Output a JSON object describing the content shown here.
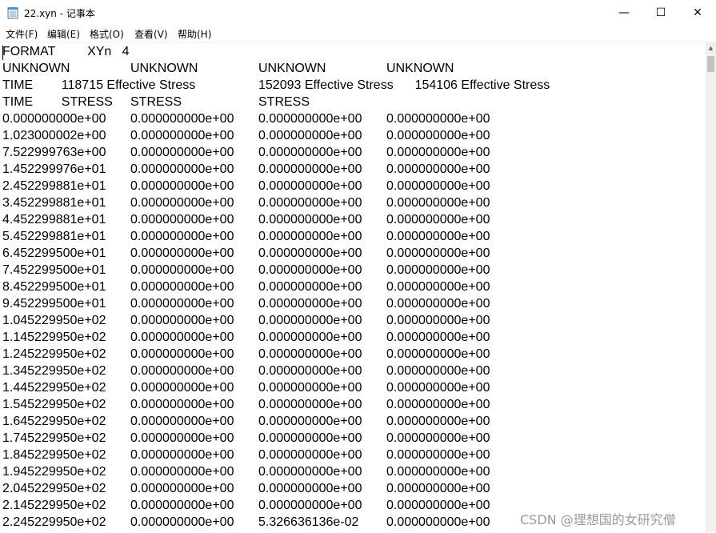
{
  "window": {
    "title": "22.xyn - 记事本",
    "minimize_glyph": "—",
    "maximize_glyph": "☐",
    "close_glyph": "✕"
  },
  "menu": [
    {
      "label": "文件(F)"
    },
    {
      "label": "编辑(E)"
    },
    {
      "label": "格式(O)"
    },
    {
      "label": "查看(V)"
    },
    {
      "label": "帮助(H)"
    }
  ],
  "icons": {
    "app": "notepad-icon",
    "scroll_up": "scroll-up-arrow-icon"
  },
  "colors": {
    "background": "#ffffff",
    "text": "#000000",
    "scrollbar": "#f0f0f0",
    "watermark": "#9a9a9a"
  },
  "content": {
    "lines": [
      [
        "FORMAT         XYn   4",
        "",
        "",
        ""
      ],
      [
        "UNKNOWN",
        "UNKNOWN",
        "UNKNOWN",
        "UNKNOWN"
      ],
      [
        "TIME        118715 Effective Stress",
        "",
        "152093 Effective Stress",
        "        154106 Effective Stress"
      ],
      [
        "TIME        STRESS",
        "STRESS",
        "STRESS",
        ""
      ],
      [
        "0.000000000e+00",
        "0.000000000e+00",
        "0.000000000e+00",
        "0.000000000e+00"
      ],
      [
        "1.023000002e+00",
        "0.000000000e+00",
        "0.000000000e+00",
        "0.000000000e+00"
      ],
      [
        "7.522999763e+00",
        "0.000000000e+00",
        "0.000000000e+00",
        "0.000000000e+00"
      ],
      [
        "1.452299976e+01",
        "0.000000000e+00",
        "0.000000000e+00",
        "0.000000000e+00"
      ],
      [
        "2.452299881e+01",
        "0.000000000e+00",
        "0.000000000e+00",
        "0.000000000e+00"
      ],
      [
        "3.452299881e+01",
        "0.000000000e+00",
        "0.000000000e+00",
        "0.000000000e+00"
      ],
      [
        "4.452299881e+01",
        "0.000000000e+00",
        "0.000000000e+00",
        "0.000000000e+00"
      ],
      [
        "5.452299881e+01",
        "0.000000000e+00",
        "0.000000000e+00",
        "0.000000000e+00"
      ],
      [
        "6.452299500e+01",
        "0.000000000e+00",
        "0.000000000e+00",
        "0.000000000e+00"
      ],
      [
        "7.452299500e+01",
        "0.000000000e+00",
        "0.000000000e+00",
        "0.000000000e+00"
      ],
      [
        "8.452299500e+01",
        "0.000000000e+00",
        "0.000000000e+00",
        "0.000000000e+00"
      ],
      [
        "9.452299500e+01",
        "0.000000000e+00",
        "0.000000000e+00",
        "0.000000000e+00"
      ],
      [
        "1.045229950e+02",
        "0.000000000e+00",
        "0.000000000e+00",
        "0.000000000e+00"
      ],
      [
        "1.145229950e+02",
        "0.000000000e+00",
        "0.000000000e+00",
        "0.000000000e+00"
      ],
      [
        "1.245229950e+02",
        "0.000000000e+00",
        "0.000000000e+00",
        "0.000000000e+00"
      ],
      [
        "1.345229950e+02",
        "0.000000000e+00",
        "0.000000000e+00",
        "0.000000000e+00"
      ],
      [
        "1.445229950e+02",
        "0.000000000e+00",
        "0.000000000e+00",
        "0.000000000e+00"
      ],
      [
        "1.545229950e+02",
        "0.000000000e+00",
        "0.000000000e+00",
        "0.000000000e+00"
      ],
      [
        "1.645229950e+02",
        "0.000000000e+00",
        "0.000000000e+00",
        "0.000000000e+00"
      ],
      [
        "1.745229950e+02",
        "0.000000000e+00",
        "0.000000000e+00",
        "0.000000000e+00"
      ],
      [
        "1.845229950e+02",
        "0.000000000e+00",
        "0.000000000e+00",
        "0.000000000e+00"
      ],
      [
        "1.945229950e+02",
        "0.000000000e+00",
        "0.000000000e+00",
        "0.000000000e+00"
      ],
      [
        "2.045229950e+02",
        "0.000000000e+00",
        "0.000000000e+00",
        "0.000000000e+00"
      ],
      [
        "2.145229950e+02",
        "0.000000000e+00",
        "0.000000000e+00",
        "0.000000000e+00"
      ],
      [
        "2.245229950e+02",
        "0.000000000e+00",
        "5.326636136e-02",
        "0.000000000e+00"
      ]
    ]
  },
  "watermark": "CSDN @理想国的女研究僧"
}
